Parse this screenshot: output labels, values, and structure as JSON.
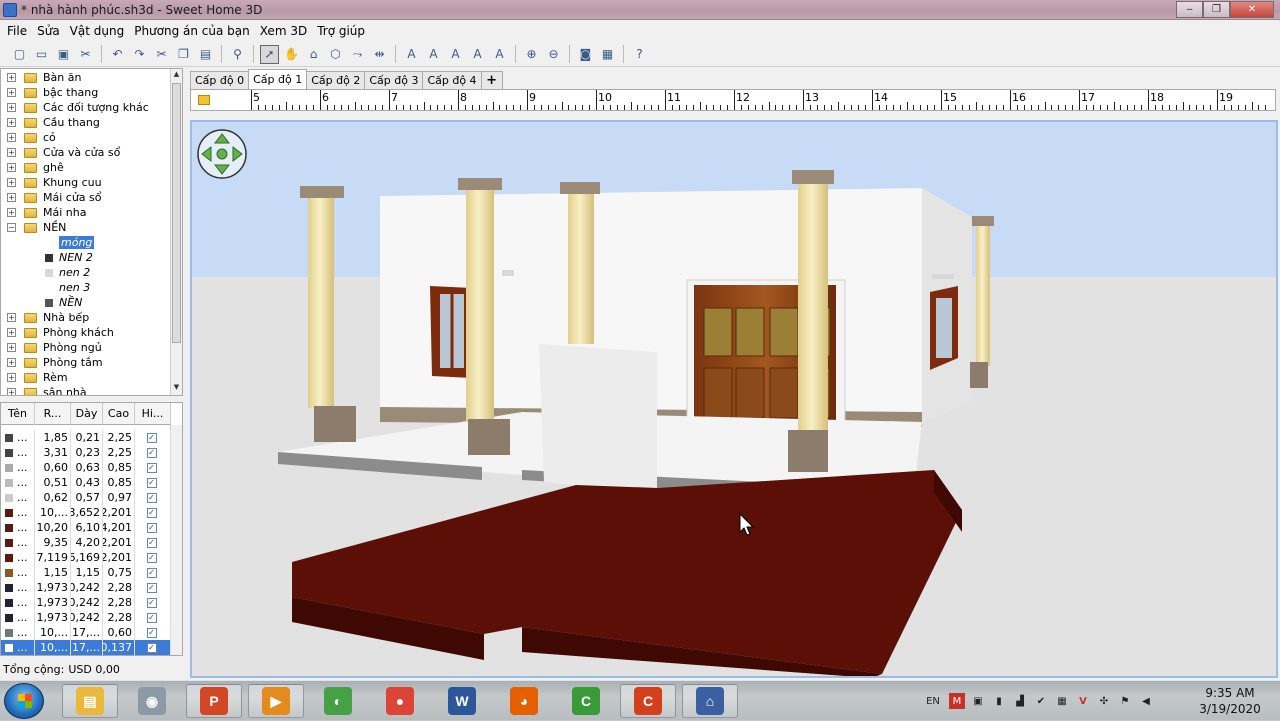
{
  "window": {
    "title": "* nhà hành phúc.sh3d - Sweet Home 3D",
    "minimize": "‒",
    "maximize": "❐",
    "close": "✕"
  },
  "menu": [
    "File",
    "Sửa",
    "Vật dụng",
    "Phương án của bạn",
    "Xem 3D",
    "Trợ giúp"
  ],
  "toolbar": [
    {
      "icon": "new-icon",
      "glyph": "▢"
    },
    {
      "icon": "open-icon",
      "glyph": "▭"
    },
    {
      "icon": "save-icon",
      "glyph": "▣"
    },
    {
      "icon": "cut-icon",
      "glyph": "✂"
    },
    {
      "icon": "undo-icon",
      "glyph": "↶"
    },
    {
      "icon": "redo-icon",
      "glyph": "↷"
    },
    {
      "icon": "cut2-icon",
      "glyph": "✂"
    },
    {
      "icon": "copy-icon",
      "glyph": "❐"
    },
    {
      "icon": "paste-icon",
      "glyph": "▤"
    },
    {
      "icon": "add-furniture-icon",
      "glyph": "⚲"
    },
    {
      "icon": "select-icon",
      "glyph": "➚"
    },
    {
      "icon": "pan-icon",
      "glyph": "✋"
    },
    {
      "icon": "create-walls-icon",
      "glyph": "⌂"
    },
    {
      "icon": "create-rooms-icon",
      "glyph": "⬡"
    },
    {
      "icon": "create-polylines-icon",
      "glyph": "⤳"
    },
    {
      "icon": "create-dimensions-icon",
      "glyph": "⇹"
    },
    {
      "icon": "add-text-icon",
      "glyph": "A"
    },
    {
      "icon": "text-style-icon",
      "glyph": "A"
    },
    {
      "icon": "text-bold-icon",
      "glyph": "A"
    },
    {
      "icon": "text-italic-icon",
      "glyph": "A"
    },
    {
      "icon": "text-size-icon",
      "glyph": "A"
    },
    {
      "icon": "zoom-in-icon",
      "glyph": "⊕"
    },
    {
      "icon": "zoom-out-icon",
      "glyph": "⊖"
    },
    {
      "icon": "photo-icon",
      "glyph": "◙"
    },
    {
      "icon": "video-icon",
      "glyph": "▦"
    },
    {
      "icon": "help-icon",
      "glyph": "?"
    }
  ],
  "catalog": {
    "categories_top": [
      "Bàn ăn",
      "bậc thang",
      "Các đối tượng khác",
      "Cầu thang",
      "cỏ",
      "Cửa và cửa sổ",
      "ghê",
      "Khung cuu",
      "Mái cửa sổ",
      "Mái nha",
      "NỀN"
    ],
    "nen_children": [
      "móng",
      "NEN 2",
      "nen 2",
      "nen 3",
      "NỀN"
    ],
    "selected_child": "móng",
    "categories_bottom": [
      "Nhà bếp",
      "Phòng khách",
      "Phòng ngủ",
      "Phòng tắm",
      "Rèm",
      "sân nhà"
    ],
    "expand_collapsed": "+",
    "expand_open": "−"
  },
  "furniture_table": {
    "headers": [
      "Tên",
      "R...",
      "Dày",
      "Cao",
      "Hi..."
    ],
    "rows": [
      {
        "name": "...",
        "w": "1,85",
        "d": "0,21",
        "h": "2,25",
        "visible": "✓"
      },
      {
        "name": "...",
        "w": "3,31",
        "d": "0,23",
        "h": "2,25",
        "visible": "✓"
      },
      {
        "name": "...",
        "w": "0,60",
        "d": "0,63",
        "h": "0,85",
        "visible": "✓"
      },
      {
        "name": "...",
        "w": "0,51",
        "d": "0,43",
        "h": "0,85",
        "visible": "✓"
      },
      {
        "name": "...",
        "w": "0,62",
        "d": "0,57",
        "h": "0,97",
        "visible": "✓"
      },
      {
        "name": "...",
        "w": "10,...",
        "d": "3,652",
        "h": "2,201",
        "visible": "✓"
      },
      {
        "name": "...",
        "w": "10,20",
        "d": "6,10",
        "h": "4,201",
        "visible": "✓"
      },
      {
        "name": "...",
        "w": "9,35",
        "d": "4,20",
        "h": "2,201",
        "visible": "✓"
      },
      {
        "name": "...",
        "w": "7,119",
        "d": "6,169",
        "h": "2,201",
        "visible": "✓"
      },
      {
        "name": "...",
        "w": "1,15",
        "d": "1,15",
        "h": "0,75",
        "visible": "✓"
      },
      {
        "name": "...",
        "w": "1,973",
        "d": "0,242",
        "h": "2,28",
        "visible": "✓"
      },
      {
        "name": "...",
        "w": "1,973",
        "d": "0,242",
        "h": "2,28",
        "visible": "✓"
      },
      {
        "name": "...",
        "w": "1,973",
        "d": "0,242",
        "h": "2,28",
        "visible": "✓"
      },
      {
        "name": "...",
        "w": "10,...",
        "d": "17,...",
        "h": "0,60",
        "visible": "✓"
      },
      {
        "name": "...",
        "w": "10,...",
        "d": "17,...",
        "h": "0,137",
        "visible": "✓"
      }
    ],
    "selected_row_index": 14,
    "total_label": "Tổng cộng:",
    "total_value": "USD 0,00"
  },
  "level_tabs": [
    "Cấp độ 0",
    "Cấp độ 1",
    "Cấp độ 2",
    "Cấp độ 3",
    "Cấp độ 4"
  ],
  "active_level": "Cấp độ 1",
  "add_level": "+",
  "ruler_labels": [
    "5",
    "6",
    "7",
    "8",
    "9",
    "10",
    "11",
    "12",
    "13",
    "14",
    "15",
    "16",
    "17",
    "18",
    "19"
  ],
  "taskbar": {
    "apps": [
      {
        "name": "file-explorer",
        "glyph": "▤",
        "color": "#e8b93a"
      },
      {
        "name": "utility-app",
        "glyph": "◉",
        "color": "#8c9aa8"
      },
      {
        "name": "powerpoint",
        "glyph": "P",
        "color": "#d24726"
      },
      {
        "name": "media-player",
        "glyph": "▶",
        "color": "#e38b1c"
      },
      {
        "name": "coccoc-browser",
        "glyph": "◐",
        "color": "#46a046"
      },
      {
        "name": "chrome",
        "glyph": "●",
        "color": "#db4437"
      },
      {
        "name": "word",
        "glyph": "W",
        "color": "#2b579a"
      },
      {
        "name": "firefox",
        "glyph": "◕",
        "color": "#e66000"
      },
      {
        "name": "camtasia-green",
        "glyph": "C",
        "color": "#3a9a3a"
      },
      {
        "name": "camtasia-red",
        "glyph": "C",
        "color": "#d4401e"
      },
      {
        "name": "sweet-home-3d",
        "glyph": "⌂",
        "color": "#3b5fa0"
      }
    ],
    "language": "EN",
    "time": "9:35 AM",
    "date": "3/19/2020"
  },
  "colors": {
    "selection": "#3d7bd9",
    "sky": "#c7daf6",
    "ground": "#e2e2e2",
    "wood_floor": "#5b0f06",
    "wall": "#ffffff",
    "column": "#f2e2a6"
  }
}
